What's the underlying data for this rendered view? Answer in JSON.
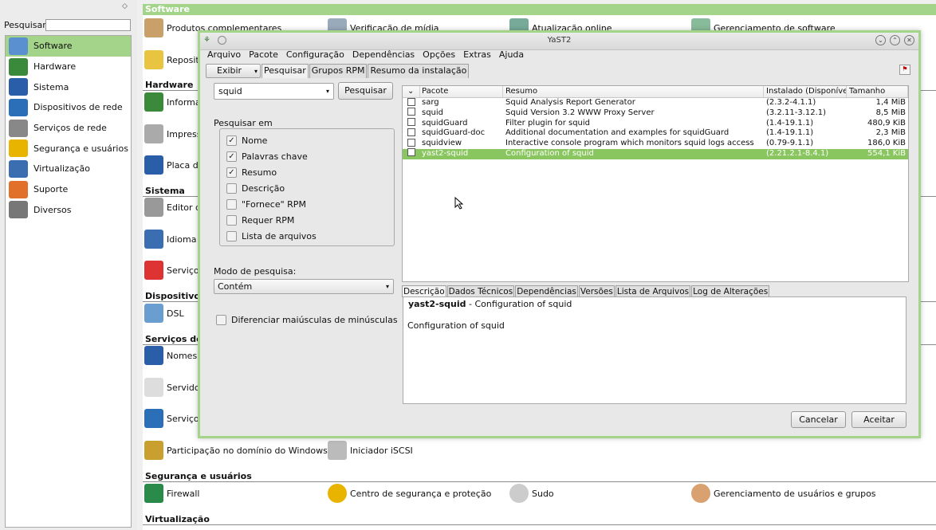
{
  "control_center": {
    "search_label": "Pesquisar",
    "search_value": "",
    "categories": [
      {
        "label": "Software",
        "icon": "software-icon",
        "color": "#5a8fd0",
        "selected": true
      },
      {
        "label": "Hardware",
        "icon": "hardware-icon",
        "color": "#3b8a3b",
        "selected": false
      },
      {
        "label": "Sistema",
        "icon": "monitor-icon",
        "color": "#2b5ea8",
        "selected": false
      },
      {
        "label": "Dispositivos de rede",
        "icon": "network-globe-icon",
        "color": "#2a6fb8",
        "selected": false
      },
      {
        "label": "Serviços de rede",
        "icon": "network-services-icon",
        "color": "#888888",
        "selected": false
      },
      {
        "label": "Segurança e usuários",
        "icon": "security-helmet-icon",
        "color": "#e8b400",
        "selected": false
      },
      {
        "label": "Virtualização",
        "icon": "virtualization-icon",
        "color": "#3a6eb0",
        "selected": false
      },
      {
        "label": "Suporte",
        "icon": "lifebuoy-icon",
        "color": "#e0702a",
        "selected": false
      },
      {
        "label": "Diversos",
        "icon": "tools-icon",
        "color": "#777777",
        "selected": false
      }
    ]
  },
  "modules": {
    "header": "Software",
    "sections": {
      "hardware": "Hardware",
      "sistema": "Sistema",
      "dispositivos": "Dispositivos",
      "servicos": "Serviços de",
      "seguranca": "Segurança e usuários",
      "virtualizacao": "Virtualização"
    },
    "items": {
      "produtos": "Produtos complementares",
      "verificacao": "Verificação de mídia",
      "atualizacao": "Atualização online",
      "gerenciamento_sw": "Gerenciamento de software",
      "reposito": "Repositó",
      "informacao": "Informaç",
      "impressora": "Impresso",
      "placa": "Placa de",
      "editor": "Editor do",
      "idioma": "Idioma",
      "servicos_sys": "Serviços",
      "dsl": "DSL",
      "nomes": "Nomes c",
      "servidor": "Servidor",
      "servicos_net": "Serviços",
      "windows_domain": "Participação no domínio do Windows",
      "iscsi": "Iniciador iSCSI",
      "firewall": "Firewall",
      "centro_seguranca": "Centro de segurança e proteção",
      "sudo": "Sudo",
      "usuarios_grupos": "Gerenciamento de usuários e grupos"
    }
  },
  "dialog": {
    "title": "YaST2",
    "menu": [
      "Arquivo",
      "Pacote",
      "Configuração",
      "Dependências",
      "Opções",
      "Extras",
      "Ajuda"
    ],
    "view_button": "Exibir",
    "tabs": [
      "Pesquisar",
      "Grupos RPM",
      "Resumo da instalação"
    ],
    "search": {
      "value": "squid",
      "button": "Pesquisar",
      "search_in_label": "Pesquisar em",
      "options": [
        {
          "label": "Nome",
          "checked": true
        },
        {
          "label": "Palavras chave",
          "checked": true
        },
        {
          "label": "Resumo",
          "checked": true
        },
        {
          "label": "Descrição",
          "checked": false
        },
        {
          "label": "\"Fornece\" RPM",
          "checked": false
        },
        {
          "label": "Requer RPM",
          "checked": false
        },
        {
          "label": "Lista de arquivos",
          "checked": false
        }
      ],
      "mode_label": "Modo de pesquisa:",
      "mode_value": "Contém",
      "case_label": "Diferenciar maiúsculas de minúsculas"
    },
    "table": {
      "headers": [
        "Pacote",
        "Resumo",
        "Instalado (Disponível)",
        "Tamanho"
      ],
      "rows": [
        {
          "name": "sarg",
          "summary": "Squid Analysis Report Generator",
          "installed": "(2.3.2-4.1.1)",
          "size": "1,4 MiB",
          "selected": false
        },
        {
          "name": "squid",
          "summary": "Squid Version 3.2 WWW Proxy Server",
          "installed": "(3.2.11-3.12.1)",
          "size": "8,5 MiB",
          "selected": false
        },
        {
          "name": "squidGuard",
          "summary": "Filter plugin for squid",
          "installed": "(1.4-19.1.1)",
          "size": "480,9 KiB",
          "selected": false
        },
        {
          "name": "squidGuard-doc",
          "summary": "Additional documentation and examples for squidGuard",
          "installed": "(1.4-19.1.1)",
          "size": "2,3 MiB",
          "selected": false
        },
        {
          "name": "squidview",
          "summary": "Interactive console program which monitors squid logs access",
          "installed": "(0.79-9.1.1)",
          "size": "186,0 KiB",
          "selected": false
        },
        {
          "name": "yast2-squid",
          "summary": "Configuration of squid",
          "installed": "(2.21.2.1-8.4.1)",
          "size": "554,1 KiB",
          "selected": true
        }
      ]
    },
    "details_tabs": [
      "Descrição",
      "Dados Técnicos",
      "Dependências",
      "Versões",
      "Lista de Arquivos",
      "Log de Alterações"
    ],
    "details": {
      "name": "yast2-squid",
      "summary": " - Configuration of squid",
      "description": "Configuration of squid"
    },
    "cancel": "Cancelar",
    "accept": "Aceitar"
  },
  "colors": {
    "accent_green": "#a3d48a",
    "selected_row": "#8ac65f"
  }
}
